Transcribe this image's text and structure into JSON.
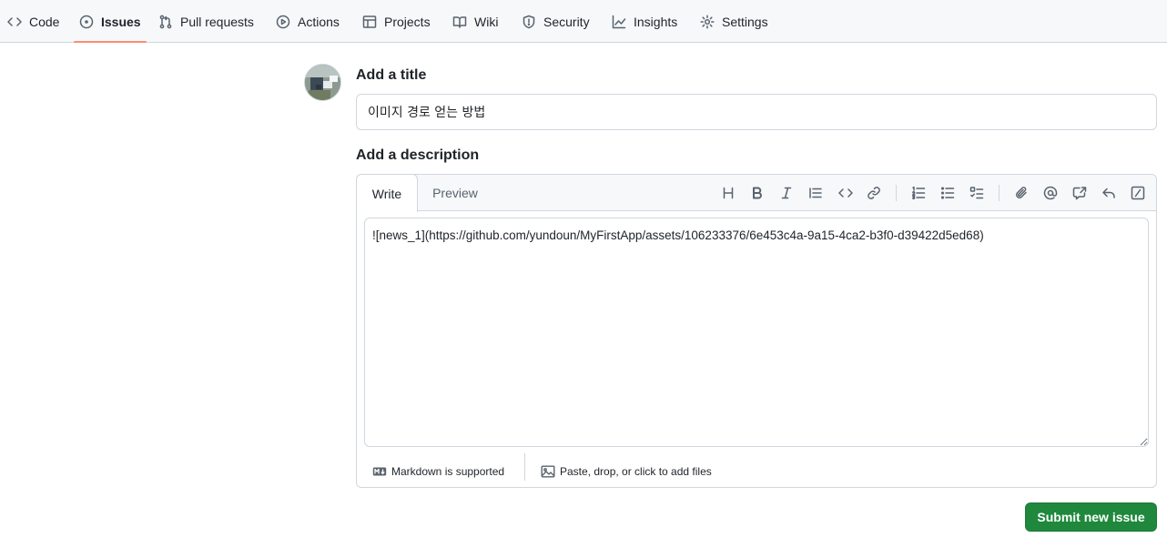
{
  "nav": {
    "tabs": [
      {
        "label": "Code"
      },
      {
        "label": "Issues"
      },
      {
        "label": "Pull requests"
      },
      {
        "label": "Actions"
      },
      {
        "label": "Projects"
      },
      {
        "label": "Wiki"
      },
      {
        "label": "Security"
      },
      {
        "label": "Insights"
      },
      {
        "label": "Settings"
      }
    ],
    "selected": "Issues"
  },
  "form": {
    "title_label": "Add a title",
    "title_value": "이미지 경로 얻는 방법",
    "description_label": "Add a description",
    "tabs": {
      "write": "Write",
      "preview": "Preview"
    },
    "body_value": "![news_1](https://github.com/yundoun/MyFirstApp/assets/106233376/6e453c4a-9a15-4ca2-b3f0-d39422d5ed68)",
    "footer": {
      "markdown": "Markdown is supported",
      "attach": "Paste, drop, or click to add files"
    },
    "submit_label": "Submit new issue"
  },
  "toolbar_icons": [
    "heading-icon",
    "bold-icon",
    "italic-icon",
    "quote-icon",
    "code-icon",
    "link-icon",
    "numbered-list-icon",
    "unordered-list-icon",
    "task-list-icon",
    "attach-icon",
    "mention-icon",
    "cross-reference-icon",
    "saved-replies-icon",
    "slash-commands-icon"
  ],
  "colors": {
    "accent_underline": "#fd8c73",
    "submit_green": "#1f883d",
    "border": "#d0d7de",
    "header_bg": "#f6f8fa"
  }
}
